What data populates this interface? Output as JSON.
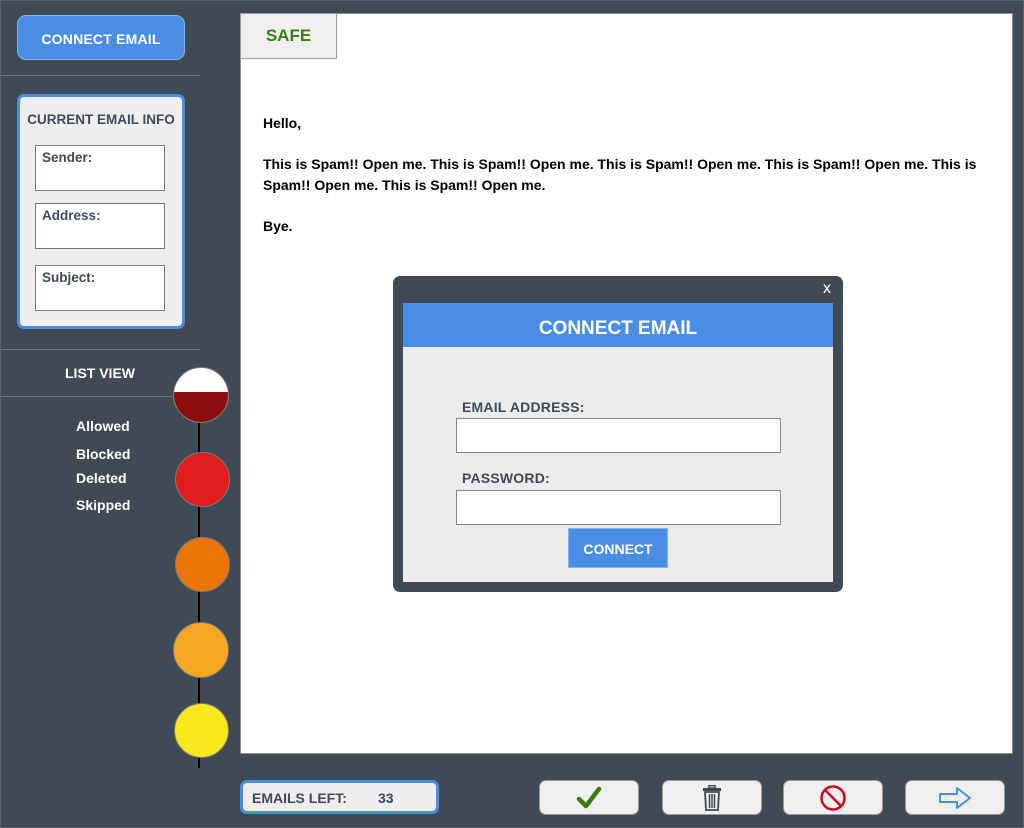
{
  "sidebar": {
    "connect_button": "CONNECT EMAIL",
    "current_email_info": {
      "title": "CURRENT EMAIL INFO",
      "sender_label": "Sender:",
      "address_label": "Address:",
      "subject_label": "Subject:"
    },
    "list_view_label": "LIST VIEW",
    "legend": [
      "Allowed",
      "Blocked",
      "Deleted",
      "Skipped"
    ]
  },
  "progress": {
    "colors": [
      "#8b0d0d",
      "#e01c1c",
      "#ec7508",
      "#f5a623",
      "#f8e71c"
    ],
    "first_fill_fraction": 0.55
  },
  "email": {
    "tab_label": "SAFE",
    "tab_color": "#3b7d0c",
    "greeting": "Hello,",
    "body": "This is Spam!! Open me. This is Spam!! Open me. This is Spam!! Open me. This is Spam!! Open me. This is Spam!! Open me. This is Spam!! Open me.",
    "closing": "Bye."
  },
  "dialog": {
    "close": "x",
    "title": "CONNECT EMAIL",
    "email_label": "EMAIL ADDRESS:",
    "email_value": "",
    "password_label": "PASSWORD:",
    "password_value": "",
    "connect_button": "CONNECT"
  },
  "footer": {
    "emails_left_label": "EMAILS LEFT:",
    "emails_left_count": "33",
    "actions": [
      "check-icon",
      "trash-icon",
      "block-icon",
      "next-arrow-icon"
    ]
  },
  "colors": {
    "accent": "#4a8ee3",
    "sidebar_bg": "#3f4a55"
  }
}
